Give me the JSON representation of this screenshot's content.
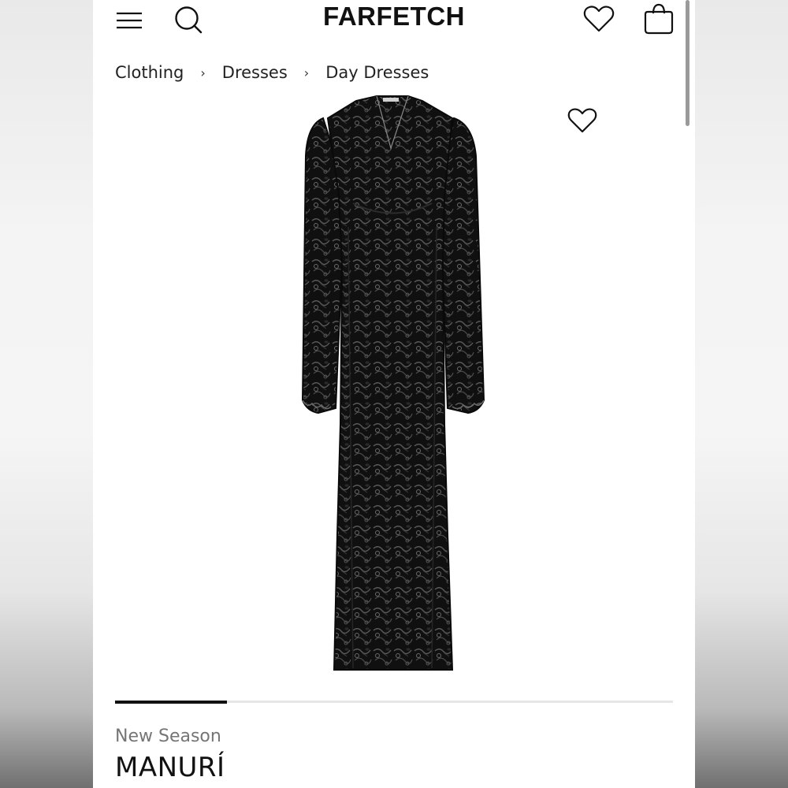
{
  "header": {
    "logo": "FARFETCH",
    "icons": [
      "menu-icon",
      "search-icon",
      "heart-icon",
      "shopping-bag-icon"
    ]
  },
  "breadcrumb": {
    "items": [
      "Clothing",
      "Dresses",
      "Day Dresses"
    ],
    "separator": "›"
  },
  "product": {
    "image_icon": "heart-icon",
    "image_description_color": "#111111",
    "carousel_progress": 0.2,
    "season": "New Season",
    "brand": "MANURÍ"
  }
}
